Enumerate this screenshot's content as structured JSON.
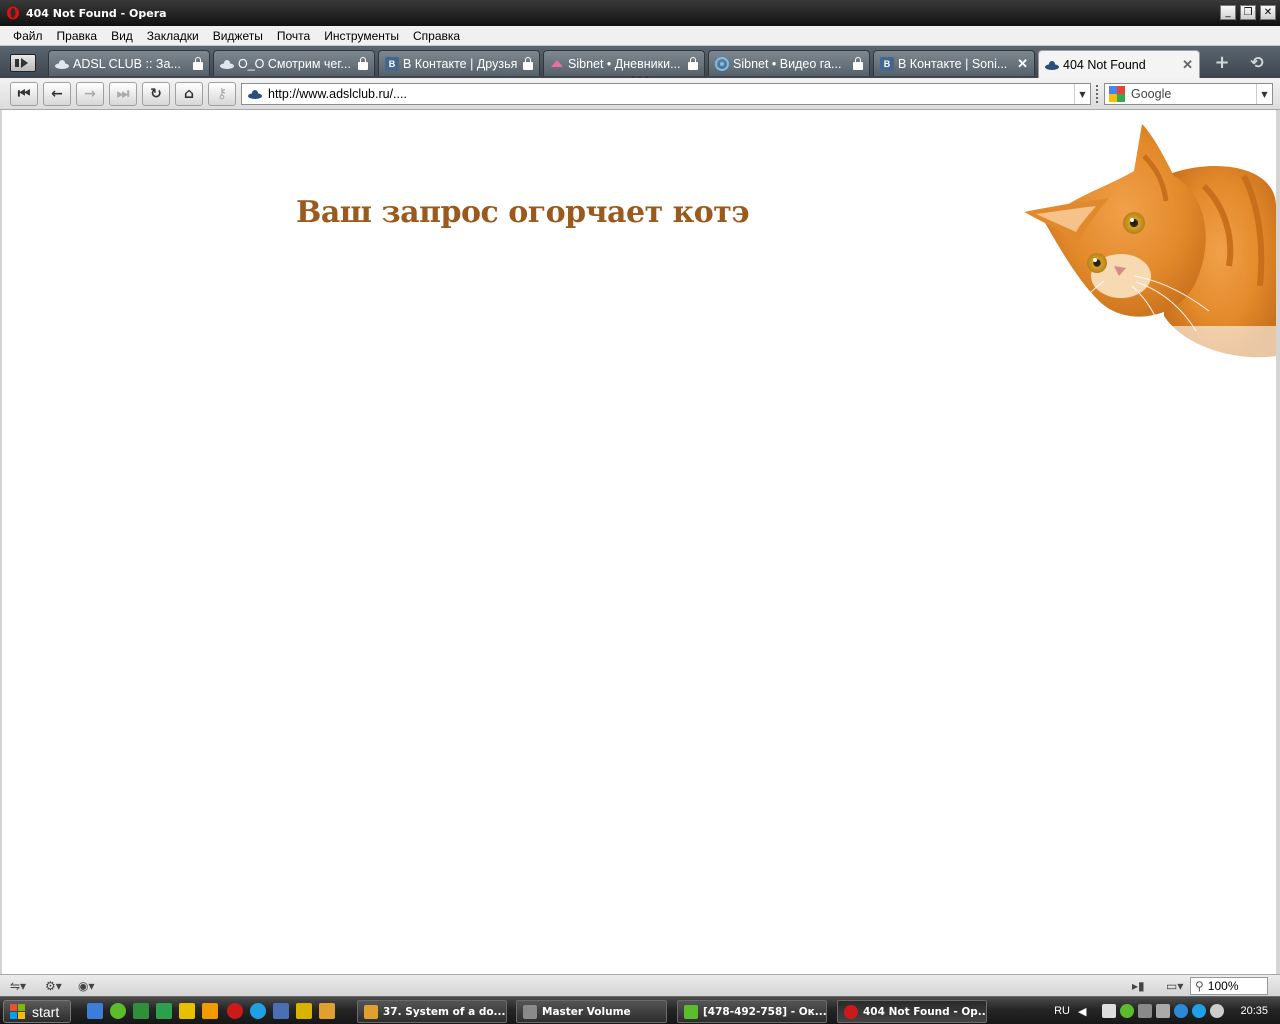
{
  "window": {
    "title": "404 Not Found - Opera",
    "buttons": [
      "minimize",
      "restore",
      "close"
    ]
  },
  "menu": [
    "Файл",
    "Правка",
    "Вид",
    "Закладки",
    "Виджеты",
    "Почта",
    "Инструменты",
    "Справка"
  ],
  "tabs": [
    {
      "label": "ADSL CLUB :: За...",
      "icon": "adsl-icon",
      "locked": true,
      "active": false
    },
    {
      "label": "О_О Смотрим чег...",
      "icon": "adsl-icon",
      "locked": true,
      "active": false
    },
    {
      "label": "В Контакте | Друзья",
      "icon": "vk-icon",
      "locked": true,
      "active": false
    },
    {
      "label": "Sibnet • Дневники...",
      "icon": "sibnet-icon",
      "locked": true,
      "active": false
    },
    {
      "label": "Sibnet • Видео га...",
      "icon": "sibnet-video-icon",
      "locked": true,
      "active": false
    },
    {
      "label": "В Контакте | Soni...",
      "icon": "vk-icon",
      "locked": false,
      "active": false
    },
    {
      "label": "404 Not Found",
      "icon": "adsl-icon",
      "locked": false,
      "active": true
    }
  ],
  "toolbar": {
    "url": "http://www.adslclub.ru/....",
    "search_engine": "Google"
  },
  "page": {
    "headline": "Ваш запрос огорчает котэ",
    "image": "orange-cat-photo"
  },
  "statusbar": {
    "zoom": "100%"
  },
  "taskbar": {
    "start_label": "start",
    "buttons": [
      {
        "label": "37. System of a do...",
        "active": false
      },
      {
        "label": "Master Volume",
        "active": false
      },
      {
        "label": "[478-492-758] - Ок...",
        "active": false
      },
      {
        "label": "404 Not Found - Op...",
        "active": true
      }
    ],
    "language": "RU",
    "clock": "20:35"
  },
  "colors": {
    "headline": "#9b5a1d",
    "tabbar": "#4a545c",
    "taskbar": "#262626"
  }
}
